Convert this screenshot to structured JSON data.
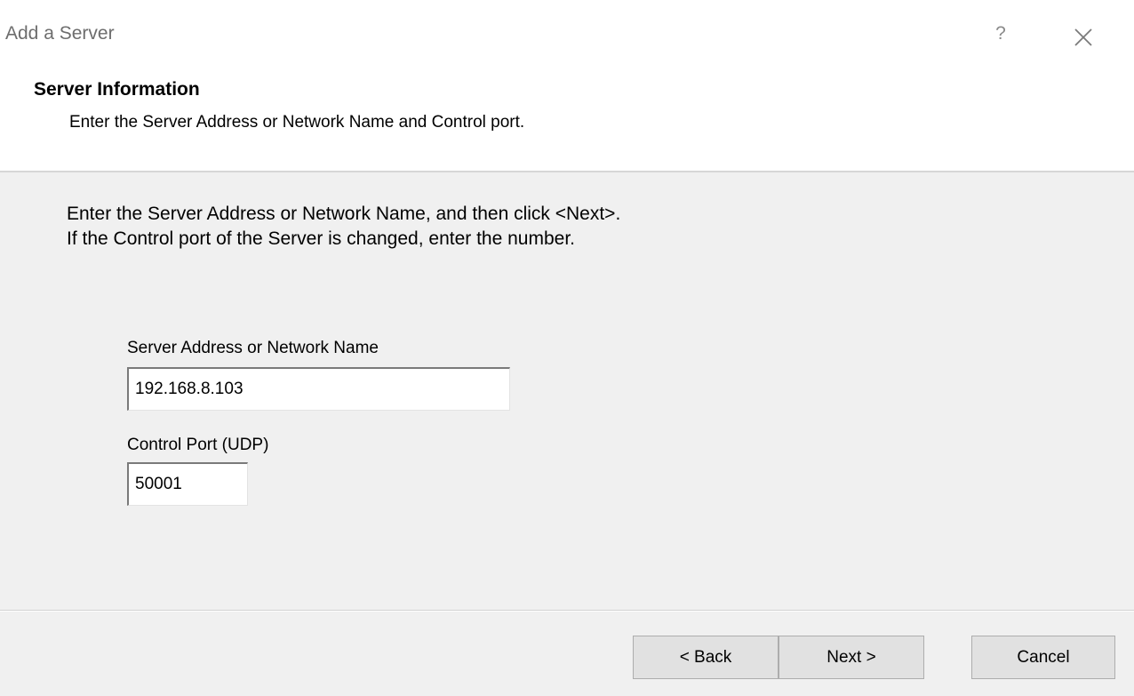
{
  "window": {
    "title": "Add a Server",
    "help_glyph": "?",
    "close_icon": "close-icon"
  },
  "header": {
    "title": "Server Information",
    "subtitle": "Enter the Server Address or Network Name and Control port."
  },
  "instructions": {
    "line1": "Enter the Server Address or Network Name, and then click <Next>.",
    "line2": "If the Control port of the Server is changed, enter the number."
  },
  "form": {
    "server_address": {
      "label": "Server Address or Network Name",
      "value": "192.168.8.103"
    },
    "control_port": {
      "label": "Control Port (UDP)",
      "value": "50001"
    }
  },
  "buttons": {
    "back": "< Back",
    "next": "Next >",
    "cancel": "Cancel"
  }
}
